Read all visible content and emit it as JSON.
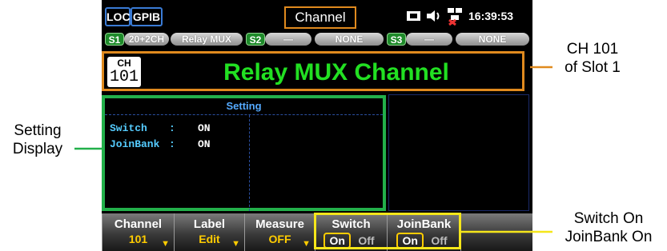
{
  "status_bar": {
    "loc": "LOC",
    "gpib": "GPIB",
    "title": "Channel",
    "time": "16:39:53"
  },
  "slot_bar": {
    "s1": "S1",
    "s1_card": "20+2CH",
    "s1_type": "Relay MUX",
    "s2": "S2",
    "s2_card": "—",
    "s2_type": "NONE",
    "s3": "S3",
    "s3_card": "—",
    "s3_type": "NONE"
  },
  "channel_header": {
    "ch_label": "CH",
    "ch_number": "101",
    "title": "Relay MUX Channel"
  },
  "setting": {
    "title": "Setting",
    "rows": [
      {
        "key": "Switch",
        "sep": ":",
        "value": "ON"
      },
      {
        "key": "JoinBank",
        "sep": ":",
        "value": "ON"
      }
    ]
  },
  "softkeys": {
    "channel": {
      "title": "Channel",
      "value": "101"
    },
    "label": {
      "title": "Label",
      "value": "Edit"
    },
    "measure": {
      "title": "Measure",
      "value": "OFF"
    },
    "switch": {
      "title": "Switch",
      "on": "On",
      "off": "Off"
    },
    "joinbank": {
      "title": "JoinBank",
      "on": "On",
      "off": "Off"
    }
  },
  "callouts": {
    "ch_line1": "CH 101",
    "ch_line2": "of Slot 1",
    "setting_line1": "Setting",
    "setting_line2": "Display",
    "switch_line1": "Switch On",
    "switch_line2": "JoinBank On"
  },
  "colors": {
    "channel_title": "#22e022",
    "orange_frame": "#e08a1e",
    "green_frame": "#22b04a",
    "yellow_frame": "#f5e61a",
    "setting_title": "#55aaff",
    "setting_key": "#55ccff",
    "value_yellow": "#ffcc00"
  },
  "icons": [
    "usb-icon",
    "speaker-icon",
    "network-disconnected-icon"
  ]
}
